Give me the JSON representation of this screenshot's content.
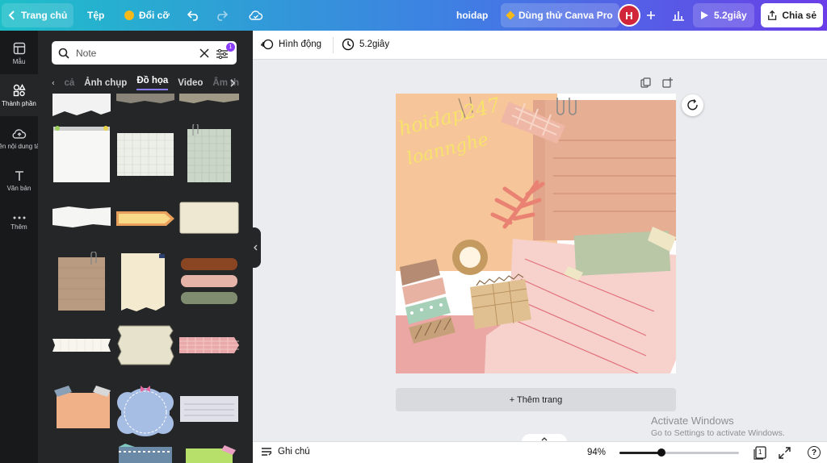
{
  "topbar": {
    "home": "Trang chủ",
    "file": "Tệp",
    "resize": "Đổi cỡ",
    "design_name": "hoidap",
    "try_pro": "Dùng thử Canva Pro",
    "avatar_letter": "H",
    "present_duration": "5.2giây",
    "share": "Chia sẻ"
  },
  "rail": [
    {
      "label": "Mẫu"
    },
    {
      "label": "Thành phần"
    },
    {
      "label": "Tải lên nội dung tải lên"
    },
    {
      "label": "Văn bản"
    },
    {
      "label": "Thêm"
    }
  ],
  "panel": {
    "search_value": "Note",
    "filter_badge": "1",
    "tabs": [
      "cả",
      "Ảnh chụp",
      "Đồ họa",
      "Video",
      "Âm th"
    ],
    "active_tab": "Đồ họa"
  },
  "toolbar": {
    "animate": "Hình động",
    "duration": "5.2giây"
  },
  "design": {
    "handwriting_line1": "hoidap247",
    "handwriting_line2": "loannghe"
  },
  "add_page": "+ Thêm trang",
  "bottombar": {
    "notes": "Ghi chú",
    "zoom": "94%",
    "page_count": "1",
    "zoom_level": 0.35
  },
  "watermark": {
    "title": "Activate Windows",
    "subtitle": "Go to Settings to activate Windows."
  },
  "colors": {
    "accent": "#8b3dff",
    "top_gradient_start": "#1ebfc9",
    "top_gradient_end": "#6a3ee8",
    "panel_bg": "#252627",
    "rail_bg": "#18191b"
  }
}
